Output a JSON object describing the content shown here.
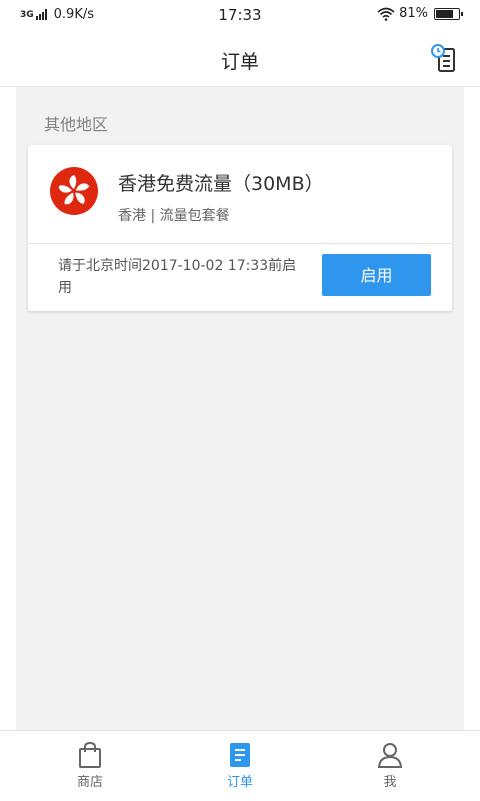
{
  "status_bar": {
    "network": "3G",
    "speed": "0.9K/s",
    "time": "17:33",
    "battery": "81%",
    "battery_level": 0.81
  },
  "header": {
    "title": "订单",
    "history_icon": "order-history-icon"
  },
  "section": {
    "title": "其他地区"
  },
  "order": {
    "flag_icon": "hong-kong-flag-icon",
    "product_name": "香港免费流量（30MB）",
    "subtitle": "香港 | 流量包套餐",
    "deadline": "请于北京时间2017-10-02 17:33前启用",
    "button_label": "启用"
  },
  "nav": {
    "items": [
      {
        "label": "商店",
        "icon": "shopping-bag-icon",
        "active": false
      },
      {
        "label": "订单",
        "icon": "order-doc-icon",
        "active": true
      },
      {
        "label": "我",
        "icon": "user-icon",
        "active": false
      }
    ]
  },
  "colors": {
    "accent": "#2f96ed",
    "flag_red": "#de2910",
    "background": "#f2f2f2"
  }
}
